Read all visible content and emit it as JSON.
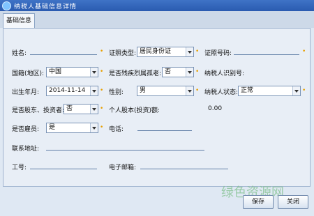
{
  "window": {
    "title": "纳税人基础信息详情"
  },
  "tabs": [
    {
      "label": "基础信息"
    }
  ],
  "form": {
    "name_label": "姓名:",
    "id_type_label": "证照类型:",
    "id_type_value": "居民身份证",
    "id_number_label": "证照号码:",
    "nationality_label": "国籍(地区):",
    "nationality_value": "中国",
    "disabled_label": "是否残疾烈属孤老:",
    "disabled_value": "否",
    "taxpayer_id_label": "纳税人识别号:",
    "birth_label": "出生年月:",
    "birth_value": "2014-11-14",
    "gender_label": "性别:",
    "gender_value": "男",
    "status_label": "纳税人状态:",
    "status_value": "正常",
    "shareholder_label": "是否股东、投资者:",
    "shareholder_value": "否",
    "equity_label": "个人股本(投资)额:",
    "equity_value": "0.00",
    "employee_label": "是否雇员:",
    "employee_value": "是",
    "phone_label": "电话:",
    "address_label": "联系地址:",
    "job_no_label": "工号:",
    "email_label": "电子邮箱:"
  },
  "buttons": {
    "save": "保存",
    "close": "关闭"
  },
  "watermark": "绿色资源网",
  "colors": {
    "titlebar": "#2a5bb0",
    "required": "#e8a000"
  }
}
